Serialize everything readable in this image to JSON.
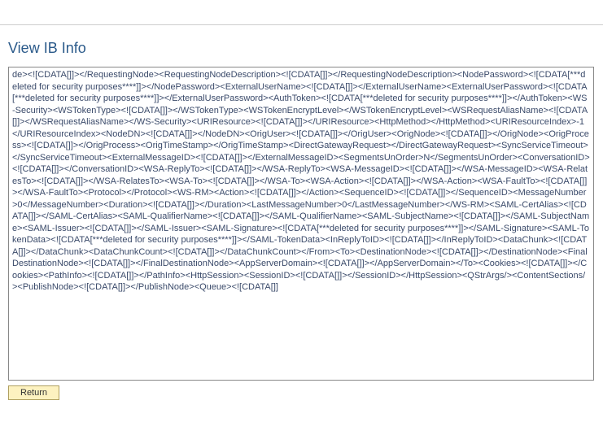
{
  "header": {
    "title": "View IB Info"
  },
  "buttons": {
    "return_label": "Return"
  },
  "xml_text": "de><![CDATA[]]></RequestingNode><RequestingNodeDescription><![CDATA[]]></RequestingNodeDescription><NodePassword><![CDATA[***deleted for security purposes****]]></NodePassword><ExternalUserName><![CDATA[]]></ExternalUserName><ExternalUserPassword><![CDATA[***deleted for security purposes****]]></ExternalUserPassword><AuthToken><![CDATA[***deleted for security purposes****]]></AuthToken><WS-Security><WSTokenType><![CDATA[]]></WSTokenType><WSTokenEncryptLevel></WSTokenEncryptLevel><WSRequestAliasName><![CDATA[]]></WSRequestAliasName></WS-Security><URIResource><![CDATA[]]></URIResource><HttpMethod></HttpMethod><URIResourceIndex>-1</URIResourceIndex><NodeDN><![CDATA[]]></NodeDN><OrigUser><![CDATA[]]></OrigUser><OrigNode><![CDATA[]]></OrigNode><OrigProcess><![CDATA[]]></OrigProcess><OrigTimeStamp></OrigTimeStamp><DirectGatewayRequest></DirectGatewayRequest><SyncServiceTimeout></SyncServiceTimeout><ExternalMessageID><![CDATA[]]></ExternalMessageID><SegmentsUnOrder>N</SegmentsUnOrder><ConversationID><![CDATA[]]></ConversationID><WSA-ReplyTo><![CDATA[]]></WSA-ReplyTo><WSA-MessageID><![CDATA[]]></WSA-MessageID><WSA-RelatesTo><![CDATA[]]></WSA-RelatesTo><WSA-To><![CDATA[]]></WSA-To><WSA-Action><![CDATA[]]></WSA-Action><WSA-FaultTo><![CDATA[]]></WSA-FaultTo><Protocol></Protocol><WS-RM><Action><![CDATA[]]></Action><SequenceID><![CDATA[]]></SequenceID><MessageNumber>0</MessageNumber><Duration><![CDATA[]]></Duration><LastMessageNumber>0</LastMessageNumber></WS-RM><SAML-CertAlias><![CDATA[]]></SAML-CertAlias><SAML-QualifierName><![CDATA[]]></SAML-QualifierName><SAML-SubjectName><![CDATA[]]></SAML-SubjectName><SAML-Issuer><![CDATA[]]></SAML-Issuer><SAML-Signature><![CDATA[***deleted for security purposes****]]></SAML-Signature><SAML-TokenData><![CDATA[***deleted for security purposes****]]></SAML-TokenData><InReplyToID><![CDATA[]]></InReplyToID><DataChunk><![CDATA[]]></DataChunk><DataChunkCount><![CDATA[]]></DataChunkCount></From><To><DestinationNode><![CDATA[]]></DestinationNode><FinalDestinationNode><![CDATA[]]></FinalDestinationNode><AppServerDomain><![CDATA[]]></AppServerDomain></To><Cookies><![CDATA[]]></Cookies><PathInfo><![CDATA[]]></PathInfo><HttpSession><SessionID><![CDATA[]]></SessionID></HttpSession><QStrArgs/><ContentSections/><PublishNode><![CDATA[]]></PublishNode><Queue><![CDATA[]]"
}
